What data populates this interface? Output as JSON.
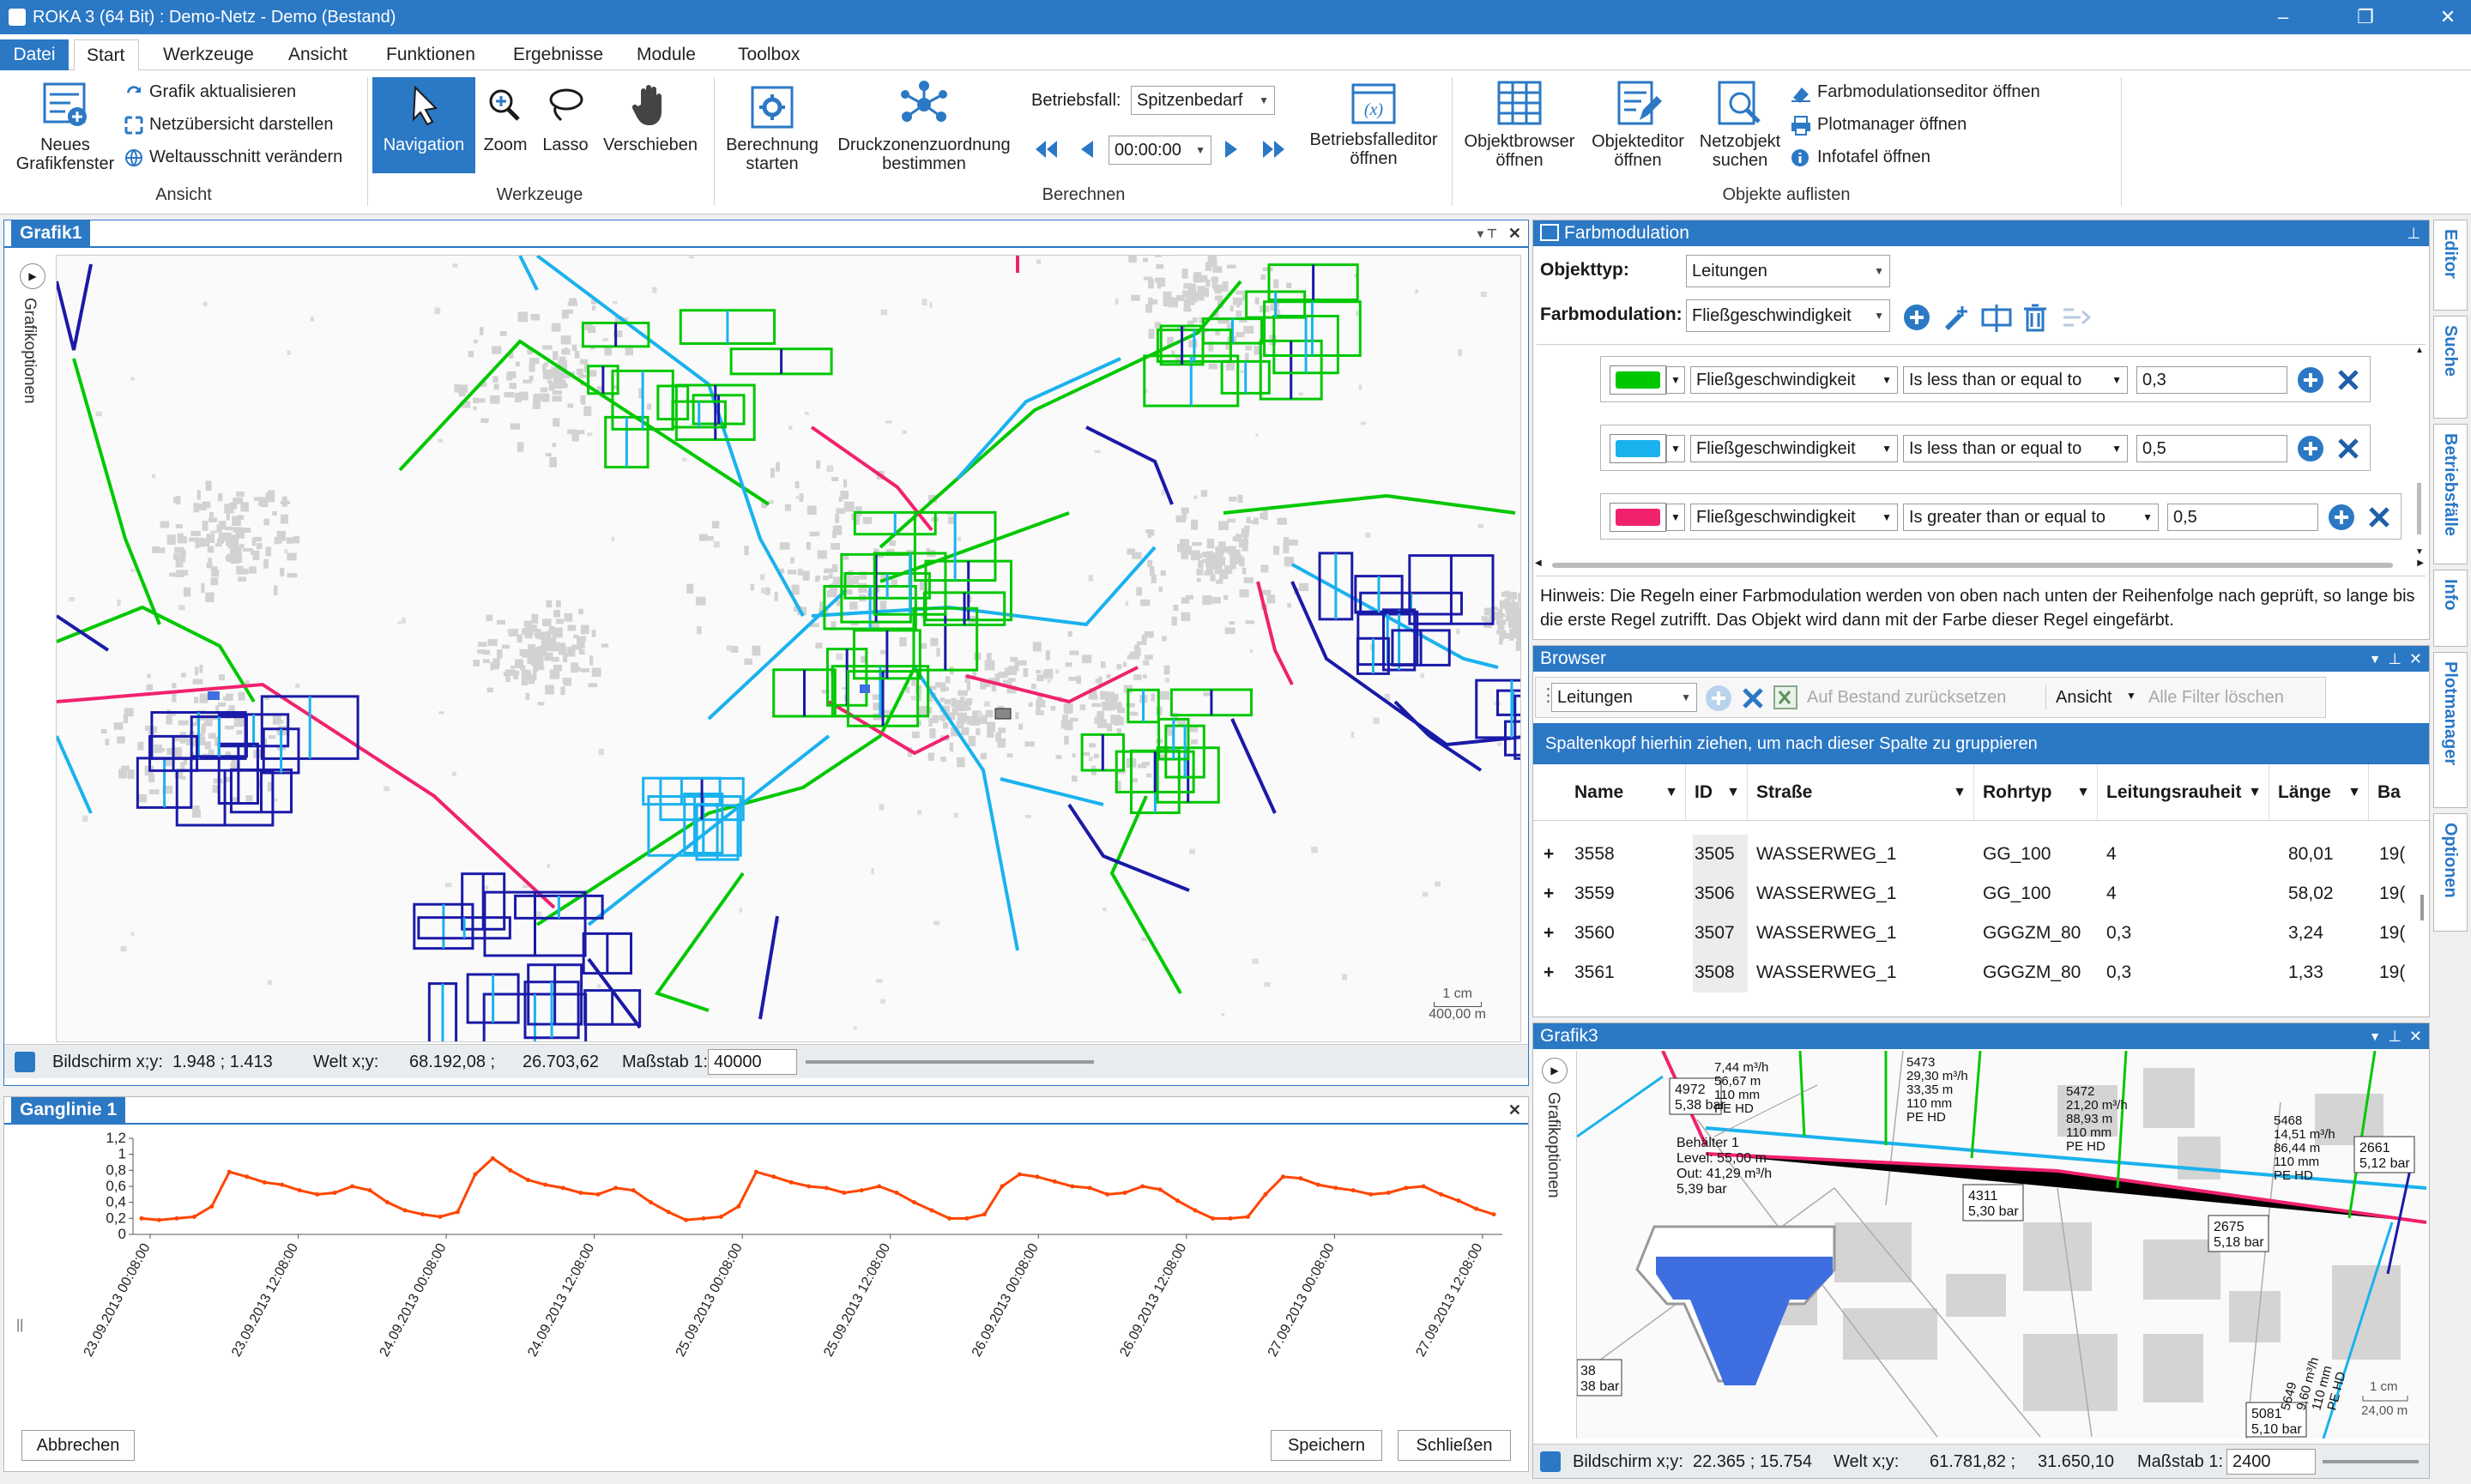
{
  "window": {
    "title": "ROKA 3 (64 Bit) : Demo-Netz - Demo (Bestand)"
  },
  "tabs": [
    "Datei",
    "Start",
    "Werkzeuge",
    "Ansicht",
    "Funktionen",
    "Ergebnisse",
    "Module",
    "Toolbox"
  ],
  "ribbon": {
    "ansicht": {
      "label": "Ansicht",
      "new_window": "Neues Grafikfenster",
      "refresh": "Grafik aktualisieren",
      "overview": "Netzübersicht darstellen",
      "world": "Weltausschnitt verändern"
    },
    "werkzeuge": {
      "label": "Werkzeuge",
      "navigation": "Navigation",
      "zoom": "Zoom",
      "lasso": "Lasso",
      "move": "Verschieben"
    },
    "berechnen": {
      "label": "Berechnen",
      "start_calc": "Berechnung starten",
      "pressure_zone": "Druckzonenzuordnung bestimmen",
      "betriebsfall_label": "Betriebsfall:",
      "betriebsfall_value": "Spitzenbedarf",
      "time_value": "00:00:00",
      "editor": "Betriebsfalleditor öffnen"
    },
    "objekte": {
      "label": "Objekte auflisten",
      "browser": "Objektbrowser öffnen",
      "editor": "Objekteditor öffnen",
      "search": "Netzobjekt suchen",
      "farbmod": "Farbmodulationseditor öffnen",
      "plot": "Plotmanager öffnen",
      "info": "Infotafel öffnen"
    }
  },
  "grafik1": {
    "title": "Grafik1",
    "options": "Grafikoptionen",
    "scale_bar": {
      "top": "1 cm",
      "bottom": "400,00 m"
    },
    "status": {
      "screen_label": "Bildschirm x;y:",
      "screen_value": "1.948 ; 1.413",
      "world_label": "Welt x;y:",
      "world_x": "68.192,08 ;",
      "world_y": "26.703,62",
      "scale_label": "Maßstab 1:",
      "scale_value": "40000"
    }
  },
  "ganglinie": {
    "title": "Ganglinie 1",
    "cancel": "Abbrechen",
    "save": "Speichern",
    "close": "Schließen"
  },
  "chart_data": {
    "type": "line",
    "title": "",
    "xlabel": "",
    "ylabel": "",
    "ylim": [
      0,
      1.2
    ],
    "y_ticks": [
      "0",
      "0,2",
      "0,4",
      "0,6",
      "0,8",
      "1",
      "1,2"
    ],
    "x_ticks": [
      "23.09.2013 00:08:00",
      "23.09.2013 12:08:00",
      "24.09.2013 00:08:00",
      "24.09.2013 12:08:00",
      "25.09.2013 00:08:00",
      "25.09.2013 12:08:00",
      "26.09.2013 00:08:00",
      "26.09.2013 12:08:00",
      "27.09.2013 00:08:00",
      "27.09.2013 12:08:00"
    ],
    "series": [
      {
        "color": "#ff4500",
        "values": [
          0.2,
          0.18,
          0.2,
          0.22,
          0.35,
          0.78,
          0.72,
          0.65,
          0.62,
          0.55,
          0.5,
          0.52,
          0.6,
          0.55,
          0.4,
          0.3,
          0.25,
          0.22,
          0.28,
          0.75,
          0.95,
          0.8,
          0.68,
          0.62,
          0.58,
          0.52,
          0.5,
          0.58,
          0.55,
          0.4,
          0.28,
          0.18,
          0.2,
          0.22,
          0.35,
          0.78,
          0.72,
          0.65,
          0.6,
          0.58,
          0.52,
          0.55,
          0.6,
          0.52,
          0.4,
          0.3,
          0.2,
          0.2,
          0.25,
          0.6,
          0.75,
          0.72,
          0.66,
          0.6,
          0.58,
          0.5,
          0.52,
          0.6,
          0.56,
          0.42,
          0.3,
          0.2,
          0.2,
          0.22,
          0.5,
          0.72,
          0.7,
          0.62,
          0.58,
          0.55,
          0.5,
          0.52,
          0.58,
          0.6,
          0.5,
          0.42,
          0.32,
          0.25
        ]
      }
    ]
  },
  "farbmodulation": {
    "title": "Farbmodulation",
    "objekttyp_label": "Objekttyp:",
    "objekttyp_value": "Leitungen",
    "farbmod_label": "Farbmodulation:",
    "farbmod_value": "Fließgeschwindigkeit",
    "rules": [
      {
        "color": "#00c800",
        "field": "Fließgeschwindigkeit",
        "op": "Is less than or equal to",
        "value": "0,3"
      },
      {
        "color": "#1ab2ee",
        "field": "Fließgeschwindigkeit",
        "op": "Is less than or equal to",
        "value": "0,5"
      },
      {
        "color": "#f0226e",
        "field": "Fließgeschwindigkeit",
        "op": "Is greater than or equal to",
        "value": "0,5"
      }
    ],
    "hint": "Hinweis: Die Regeln einer Farbmodulation werden von oben nach unten der Reihenfolge nach geprüft, so lange bis die erste Regel zutrifft. Das Objekt wird dann mit der Farbe dieser Regel eingefärbt."
  },
  "browser": {
    "title": "Browser",
    "type": "Leitungen",
    "reset": "Auf Bestand zurücksetzen",
    "view": "Ansicht",
    "clear": "Alle Filter löschen",
    "group_hint": "Spaltenkopf hierhin ziehen, um nach dieser Spalte zu gruppieren",
    "columns": [
      "Name",
      "ID",
      "Straße",
      "Rohrtyp",
      "Leitungsrauheit",
      "Länge",
      "Ba"
    ],
    "rows": [
      [
        "3558",
        "3505",
        "WASSERWEG_1",
        "GG_100",
        "4",
        "80,01",
        "19("
      ],
      [
        "3559",
        "3506",
        "WASSERWEG_1",
        "GG_100",
        "4",
        "58,02",
        "19("
      ],
      [
        "3560",
        "3507",
        "WASSERWEG_1",
        "GGGZM_80",
        "0,3",
        "3,24",
        "19("
      ],
      [
        "3561",
        "3508",
        "WASSERWEG_1",
        "GGGZM_80",
        "0,3",
        "1,33",
        "19("
      ]
    ]
  },
  "grafik3": {
    "title": "Grafik3",
    "options": "Grafikoptionen",
    "labels": {
      "n4972": "4972",
      "n4972p": "5,38 bar",
      "behaelter": "Behälter 1",
      "level": "Level: 55,00 m",
      "out": "Out: 41,29 m³/h",
      "bp": "5,39 bar",
      "n4311": "4311",
      "n4311p": "5,30 bar",
      "n2675": "2675",
      "n2675p": "5,18 bar",
      "n2661": "2661",
      "n2661p": "5,12 bar",
      "n5081": "5081",
      "n5081p": "5,10 bar",
      "n38": "38",
      "n38p": "38 bar",
      "p5473": "5473",
      "p5473a": "29,30 m³/h",
      "p5473b": "33,35 m",
      "p5473c": "110 mm",
      "p5473d": "PE HD",
      "p5472": "5472",
      "p5472a": "21,20 m³/h",
      "p5472b": "88,93 m",
      "p5472c": "110 mm",
      "p5472d": "PE HD",
      "p5468": "5468",
      "p5468a": "14,51 m³/h",
      "p5468b": "86,44 m",
      "p5468c": "110 mm",
      "p5468d": "PE HD",
      "pl": "7,44 m³/h",
      "pl2": "56,67 m",
      "pl3": "110 mm",
      "pl4": "PE HD",
      "p5649": "5649",
      "p5649a": "9,60 m³/h",
      "p5649b": "110 mm",
      "p5649c": "PE HD",
      "scale_top": "1 cm",
      "scale_bottom": "24,00 m"
    },
    "status": {
      "screen_label": "Bildschirm x;y:",
      "screen_value": "22.365 ; 15.754",
      "world_label": "Welt x;y:",
      "world_x": "61.781,82 ;",
      "world_y": "31.650,10",
      "scale_label": "Maßstab 1:",
      "scale_value": "2400"
    }
  },
  "side_tabs": [
    "Editor",
    "Suche",
    "Betriebsfälle",
    "Info",
    "Plotmanager",
    "Optionen"
  ],
  "colors": {
    "accent": "#2b78c5",
    "green": "#00c800",
    "blue": "#1ab2ee",
    "pink": "#f0226e",
    "navy": "#1a1aa8"
  }
}
